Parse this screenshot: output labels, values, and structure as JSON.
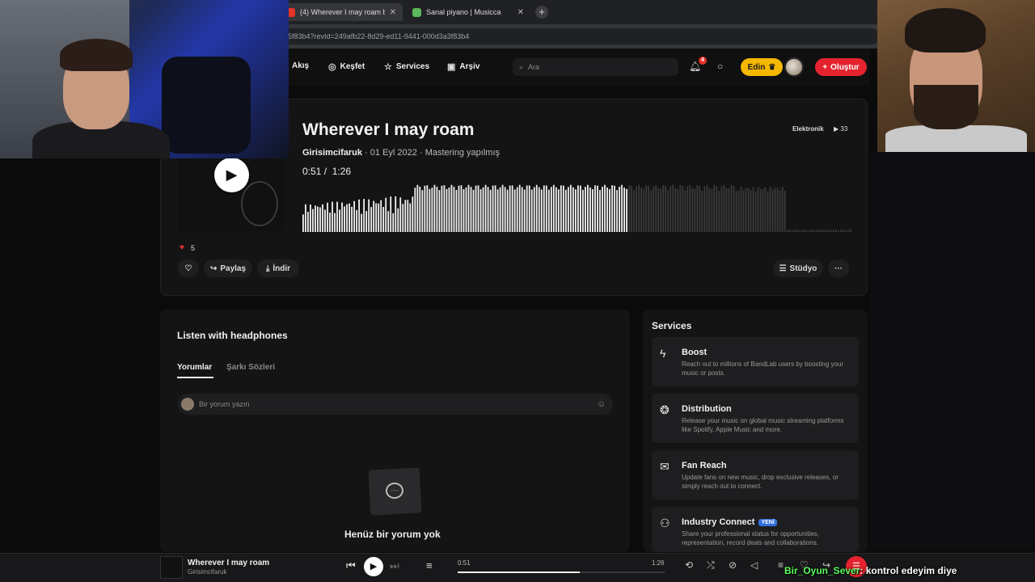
{
  "browser": {
    "tabs": [
      {
        "title": "(4) Wherever I may roam beste",
        "active": true,
        "favicon_color": "#e5332a"
      },
      {
        "title": "Sanal piyano | Musicca",
        "active": false,
        "favicon_color": "#5cb85c"
      }
    ],
    "url": "5f83b4?revId=249afb22-8d29-ed11-9441-000d3a3f83b4"
  },
  "nav": {
    "items": [
      {
        "label": "Akış",
        "icon": "feed-icon"
      },
      {
        "label": "Keşfet",
        "icon": "compass-icon"
      },
      {
        "label": "Services",
        "icon": "star-icon"
      },
      {
        "label": "Arşiv",
        "icon": "archive-icon"
      }
    ],
    "search_placeholder": "Ara",
    "notification_count": "4",
    "edin_label": "Edin",
    "create_label": "Oluştur"
  },
  "track": {
    "title": "Wherever I may roam",
    "artist": "Girisimcifaruk",
    "date": "01 Eyl 2022",
    "status": "Mastering yapılmış",
    "current_time": "0:51",
    "duration": "1:26",
    "genre": "Elektronik",
    "plays": "33",
    "likes": "5",
    "progress_fraction": 0.59
  },
  "actions": {
    "share_label": "Paylaş",
    "download_label": "İndir",
    "studio_label": "Stüdyo"
  },
  "comments": {
    "heading": "Listen with headphones",
    "tabs": [
      "Yorumlar",
      "Şarkı Sözleri"
    ],
    "input_placeholder": "Bir yorum yazın",
    "empty_text": "Henüz bir yorum yok"
  },
  "services": {
    "heading": "Services",
    "items": [
      {
        "name": "Boost",
        "desc": "Reach out to millions of BandLab users by boosting your music or posts.",
        "icon": "lightning-icon",
        "badge": ""
      },
      {
        "name": "Distribution",
        "desc": "Release your music on global music streaming platforms like Spotify, Apple Music and more.",
        "icon": "distribution-icon",
        "badge": ""
      },
      {
        "name": "Fan Reach",
        "desc": "Update fans on new music, drop exclusive releases, or simply reach out to connect.",
        "icon": "mail-icon",
        "badge": ""
      },
      {
        "name": "Industry Connect",
        "desc": "Share your professional status for opportunities, representation, record deals and collaborations.",
        "icon": "people-icon",
        "badge": "YENİ"
      }
    ]
  },
  "player": {
    "title": "Wherever I may roam",
    "artist": "Girisimcifaruk",
    "current_time": "0:51",
    "duration": "1:26"
  },
  "stream_chat": {
    "user": "Bir_Oyun_Sever",
    "message": ": kontrol edeyim diye"
  },
  "colors": {
    "accent_red": "#e5232e",
    "edin_yellow": "#f5b800",
    "background": "#0b0b0c",
    "card": "#141415",
    "chat_username": "#5cff5c"
  }
}
